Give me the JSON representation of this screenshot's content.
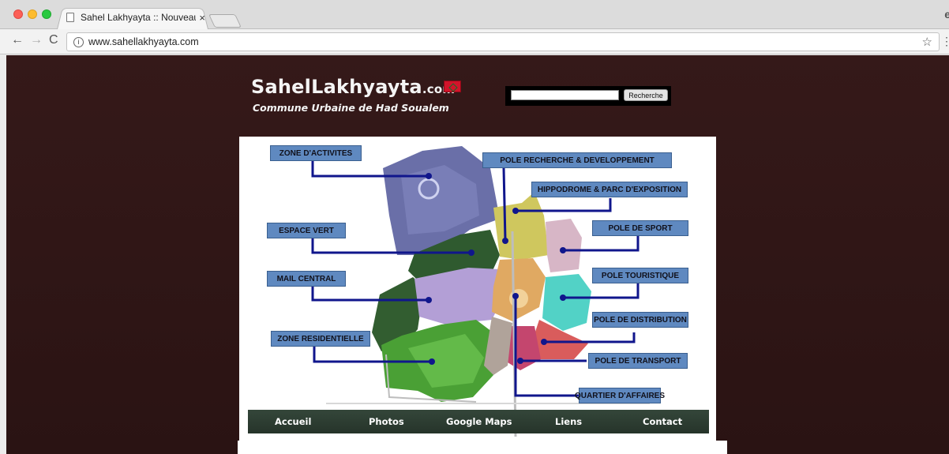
{
  "browser": {
    "tab_title": "Sahel Lakhyayta :: Nouveau p",
    "tab_close": "×",
    "url": "www.sahellakhyayta.com",
    "nav_back": "←",
    "nav_forward": "→",
    "nav_reload": "C",
    "info": "i",
    "star": "☆",
    "menu": "⋮",
    "profile": "e"
  },
  "header": {
    "site_name": "SahelLakhyayta",
    "site_suffix": ".com",
    "subtitle": "Commune Urbaine de Had Soualem"
  },
  "search": {
    "value": "",
    "button_label": "Recherche"
  },
  "map_labels": {
    "zone_activites": "ZONE D'ACTIVITES",
    "pole_recherche": "POLE RECHERCHE & DEVELOPPEMENT",
    "hippodrome": "HIPPODROME & PARC D'EXPOSITION",
    "espace_vert": "ESPACE VERT",
    "pole_sport": "POLE DE SPORT",
    "mail_central": "MAIL CENTRAL",
    "pole_touristique": "POLE TOURISTIQUE",
    "pole_distribution": "POLE DE DISTRIBUTION",
    "zone_residentielle": "ZONE RESIDENTIELLE",
    "pole_transport": "POLE DE TRANSPORT",
    "quartier_affaires": "QUARTIER D'AFFAIRES"
  },
  "nav": {
    "items": [
      "Accueil",
      "Photos",
      "Google Maps",
      "Liens",
      "Contact"
    ]
  },
  "colors": {
    "page_background": "#2c1414",
    "label_fill": "#5f89c0",
    "leader_line": "#10168c",
    "navbar": "#2b3a2c"
  }
}
